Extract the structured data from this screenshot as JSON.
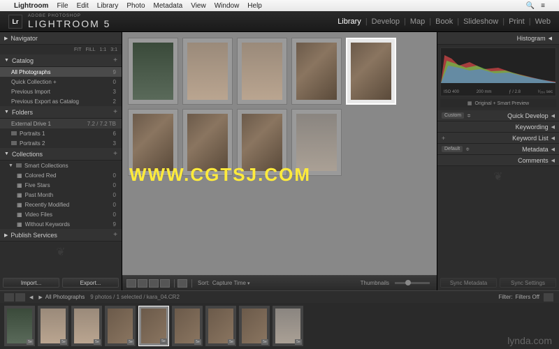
{
  "menubar": {
    "app": "Lightroom",
    "items": [
      "File",
      "Edit",
      "Library",
      "Photo",
      "Metadata",
      "View",
      "Window",
      "Help"
    ]
  },
  "header": {
    "logo": "Lr",
    "top": "ADOBE PHOTOSHOP",
    "name": "LIGHTROOM 5"
  },
  "modules": [
    "Library",
    "Develop",
    "Map",
    "Book",
    "Slideshow",
    "Print",
    "Web"
  ],
  "active_module": "Library",
  "left": {
    "navigator": {
      "title": "Navigator",
      "modes": [
        "FIT",
        "FILL",
        "1:1",
        "3:1"
      ]
    },
    "catalog": {
      "title": "Catalog",
      "items": [
        {
          "label": "All Photographs",
          "count": 9,
          "selected": true
        },
        {
          "label": "Quick Collection +",
          "count": 0
        },
        {
          "label": "Previous Import",
          "count": 3
        },
        {
          "label": "Previous Export as Catalog",
          "count": 2
        }
      ]
    },
    "folders": {
      "title": "Folders",
      "drive": {
        "name": "External Drive 1",
        "usage": "7.2 / 7.2 TB"
      },
      "items": [
        {
          "label": "Portraits 1",
          "count": 6
        },
        {
          "label": "Portraits 2",
          "count": 3
        }
      ]
    },
    "collections": {
      "title": "Collections",
      "smart": "Smart Collections",
      "items": [
        {
          "label": "Colored Red",
          "count": 0
        },
        {
          "label": "Five Stars",
          "count": 0
        },
        {
          "label": "Past Month",
          "count": 0
        },
        {
          "label": "Recently Modified",
          "count": 0
        },
        {
          "label": "Video Files",
          "count": 0
        },
        {
          "label": "Without Keywords",
          "count": 9
        }
      ]
    },
    "publish": {
      "title": "Publish Services"
    },
    "buttons": {
      "import": "Import...",
      "export": "Export..."
    }
  },
  "right": {
    "histogram": {
      "title": "Histogram",
      "info": {
        "iso": "ISO 400",
        "focal": "200 mm",
        "aperture": "ƒ / 2.8",
        "shutter": "¹⁄₂₅₀ sec"
      },
      "preview": "Original + Smart Preview"
    },
    "panels": [
      {
        "dd": "Custom",
        "label": "Quick Develop"
      },
      {
        "dd": null,
        "label": "Keywording"
      },
      {
        "dd": null,
        "label": "Keyword List",
        "plus": true
      },
      {
        "dd": "Default",
        "label": "Metadata"
      },
      {
        "dd": null,
        "label": "Comments"
      }
    ],
    "buttons": {
      "sync_meta": "Sync Metadata",
      "sync_set": "Sync Settings"
    }
  },
  "toolbar": {
    "sort_label": "Sort:",
    "sort_value": "Capture Time",
    "thumbs_label": "Thumbnails"
  },
  "status": {
    "source": "All Photographs",
    "summary": "9 photos / 1 selected / kara_04.CR2",
    "filter_label": "Filter:",
    "filter_value": "Filters Off"
  },
  "grid": {
    "count": 9,
    "selected_index": 4
  },
  "filmstrip_badge": "5e",
  "watermark": "WWW.CGTSJ.COM",
  "watermark2": "lynda.com"
}
